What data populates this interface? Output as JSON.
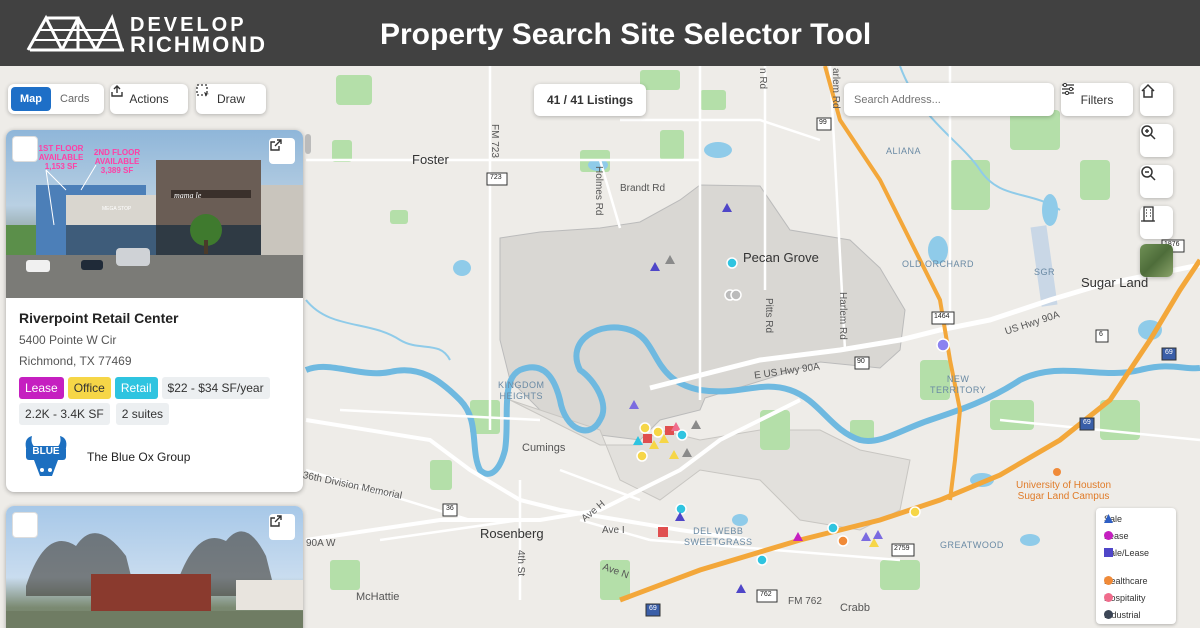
{
  "header": {
    "logo_line1": "DEVELOP",
    "logo_line2": "RICHMOND",
    "title": "Property Search Site Selector Tool",
    "bg_color": "#414141"
  },
  "toolbar": {
    "tabs": [
      {
        "label": "Map",
        "active": true
      },
      {
        "label": "Cards",
        "active": false
      }
    ],
    "actions_label": "Actions",
    "draw_label": "Draw",
    "listings_count": "41 / 41 Listings",
    "search_placeholder": "Search Address...",
    "filters_label": "Filters"
  },
  "map_buttons": [
    "home-icon",
    "zoom-in-icon",
    "zoom-out-icon",
    "buildings-icon",
    "satellite-thumbnail"
  ],
  "map_labels": {
    "foster": "Foster",
    "pecan_grove": "Pecan Grove",
    "sugar_land": "Sugar Land",
    "aliana": "ALIANA",
    "old_orchard": "OLD ORCHARD",
    "sgr": "SGR",
    "new_territory_1": "NEW",
    "new_territory_2": "TERRITORY",
    "kingdom_heights_1": "KINGDOM",
    "kingdom_heights_2": "HEIGHTS",
    "cumings": "Cumings",
    "rosenberg": "Rosenberg",
    "del_webb_1": "DEL WEBB",
    "del_webb_2": "SWEETGRASS",
    "greatwood": "GREATWOOD",
    "mchattie": "McHattie",
    "crabb": "Crabb",
    "uh_1": "University of Houston",
    "uh_2": "Sugar Land Campus",
    "brandt_rd": "Brandt Rd",
    "holmes_rd": "Holmes Rd",
    "pitts_rd": "Pitts Rd",
    "harlem_rd": "Harlem Rd",
    "harlem_rd_top": "arlem Rd",
    "n_rd_top": "n Rd",
    "fm723": "FM 723",
    "e_us_hwy_90a": "E US Hwy 90A",
    "us_hwy_90a": "US Hwy 90A",
    "division_memorial": "36th Division Memorial",
    "ave_h": "Ave H",
    "ave_i": "Ave I",
    "ave_n": "Ave N",
    "fm762": "FM 762",
    "st_4th": "4th St",
    "w_90a": "90A W",
    "shield_99": "99",
    "shield_723": "723",
    "shield_90": "90",
    "shield_1464": "1464",
    "shield_6": "6",
    "shield_69": "69",
    "shield_36": "36",
    "shield_2759": "2759",
    "shield_762": "762",
    "shield_1876": "1876"
  },
  "listing_card": {
    "name": "Riverpoint Retail Center",
    "address_line1": "5400 Pointe W Cir",
    "address_line2": "Richmond, TX 77469",
    "tags": [
      "Lease",
      "Office",
      "Retail"
    ],
    "price": "$22 - $34 SF/year",
    "size": "2.2K - 3.4K SF",
    "suites": "2 suites",
    "broker": "The Blue Ox Group",
    "broker_logo_text": "BLUE",
    "photo_banner_1": "1ST FLOOR AVAILABLE 1,153 SF",
    "photo_banner_2": "2ND FLOOR AVAILABLE 3,389 SF",
    "photo_sign": "mama le"
  },
  "legend": {
    "items": [
      {
        "label": "Sale",
        "shape": "triangle",
        "color": "#2f5fc4"
      },
      {
        "label": "Lease",
        "shape": "circle",
        "color": "#c51fc0"
      },
      {
        "label": "Sale/Lease",
        "shape": "square",
        "color": "#4f46c8"
      },
      {
        "label": "Healthcare",
        "shape": "circle",
        "color": "#f08a38"
      },
      {
        "label": "Hospitality",
        "shape": "circle",
        "color": "#f06c8c"
      },
      {
        "label": "Industrial",
        "shape": "circle",
        "color": "#3c4656"
      }
    ]
  },
  "colors": {
    "accent": "#1e6fc7",
    "water": "#7ec4e6",
    "park": "#a8d9a0",
    "highway": "#f5a623",
    "city_area": "#dcdad6"
  }
}
